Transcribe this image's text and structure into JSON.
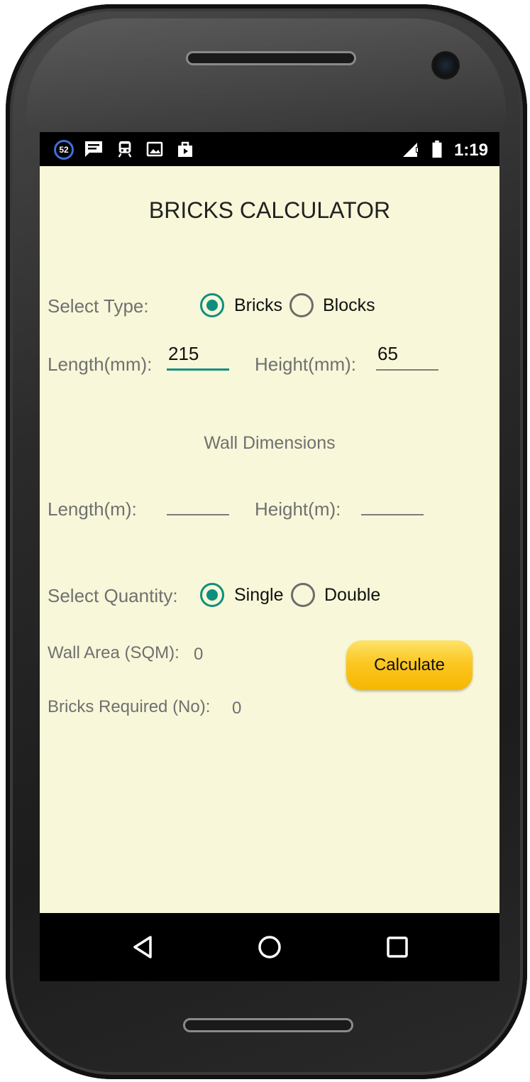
{
  "status_bar": {
    "notification_badge": "52",
    "icons": [
      "notification-count-icon",
      "message-icon",
      "train-icon",
      "image-icon",
      "play-store-icon"
    ],
    "signal_icon": "signal-icon",
    "battery_icon": "battery-icon",
    "time": "1:19"
  },
  "app": {
    "title": "BRICKS CALCULATOR",
    "select_type": {
      "label": "Select Type:",
      "options": [
        "Bricks",
        "Blocks"
      ],
      "selected": "Bricks"
    },
    "brick_length": {
      "label": "Length(mm):",
      "value": "215"
    },
    "brick_height": {
      "label": "Height(mm):",
      "value": "65"
    },
    "wall_section_title": "Wall Dimensions",
    "wall_length": {
      "label": "Length(m):",
      "value": ""
    },
    "wall_height": {
      "label": "Height(m):",
      "value": ""
    },
    "select_quantity": {
      "label": "Select Quantity:",
      "options": [
        "Single",
        "Double"
      ],
      "selected": "Single"
    },
    "wall_area": {
      "label": "Wall Area (SQM):",
      "value": "0"
    },
    "bricks_required": {
      "label": "Bricks Required (No):",
      "value": "0"
    },
    "calculate_label": "Calculate",
    "colors": {
      "background": "#f8f7d9",
      "accent": "#0e8f7e",
      "button": "#fcc722"
    }
  },
  "nav_bar": {
    "icons": [
      "back-icon",
      "home-icon",
      "recents-icon"
    ]
  }
}
